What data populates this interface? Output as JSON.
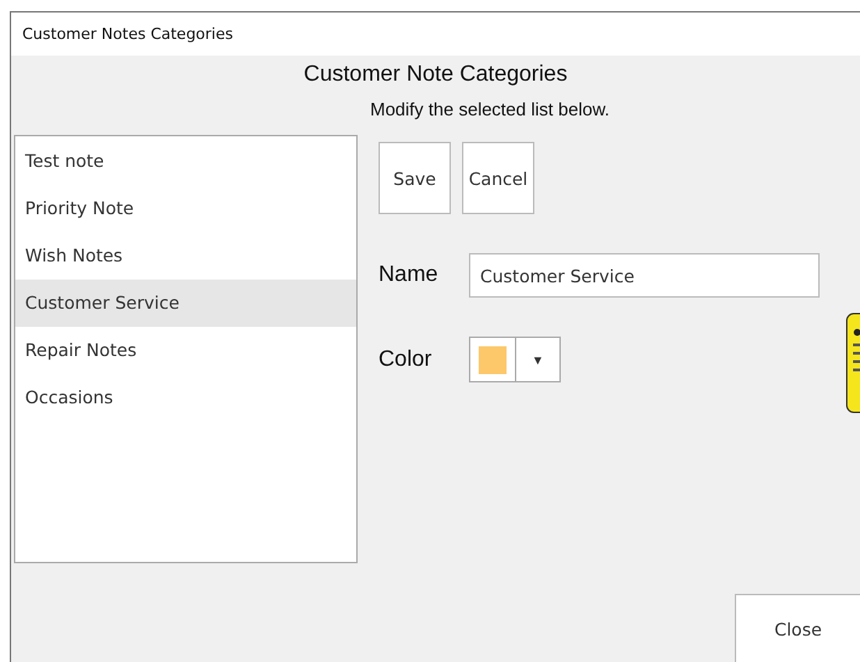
{
  "window": {
    "title": "Customer Notes Categories"
  },
  "heading": "Customer Note Categories",
  "subtitle": "Modify the selected list below.",
  "categories": [
    {
      "label": "Test note",
      "selected": false
    },
    {
      "label": "Priority Note",
      "selected": false
    },
    {
      "label": "Wish Notes",
      "selected": false
    },
    {
      "label": "Customer Service",
      "selected": true
    },
    {
      "label": "Repair Notes",
      "selected": false
    },
    {
      "label": "Occasions",
      "selected": false
    }
  ],
  "buttons": [
    "Save",
    "Cancel"
  ],
  "name_field": {
    "label": "Name",
    "value": "Customer Service"
  },
  "color_field": {
    "label": "Color",
    "color": "#fdc86a",
    "caret": "▼"
  },
  "close_button": "Close"
}
